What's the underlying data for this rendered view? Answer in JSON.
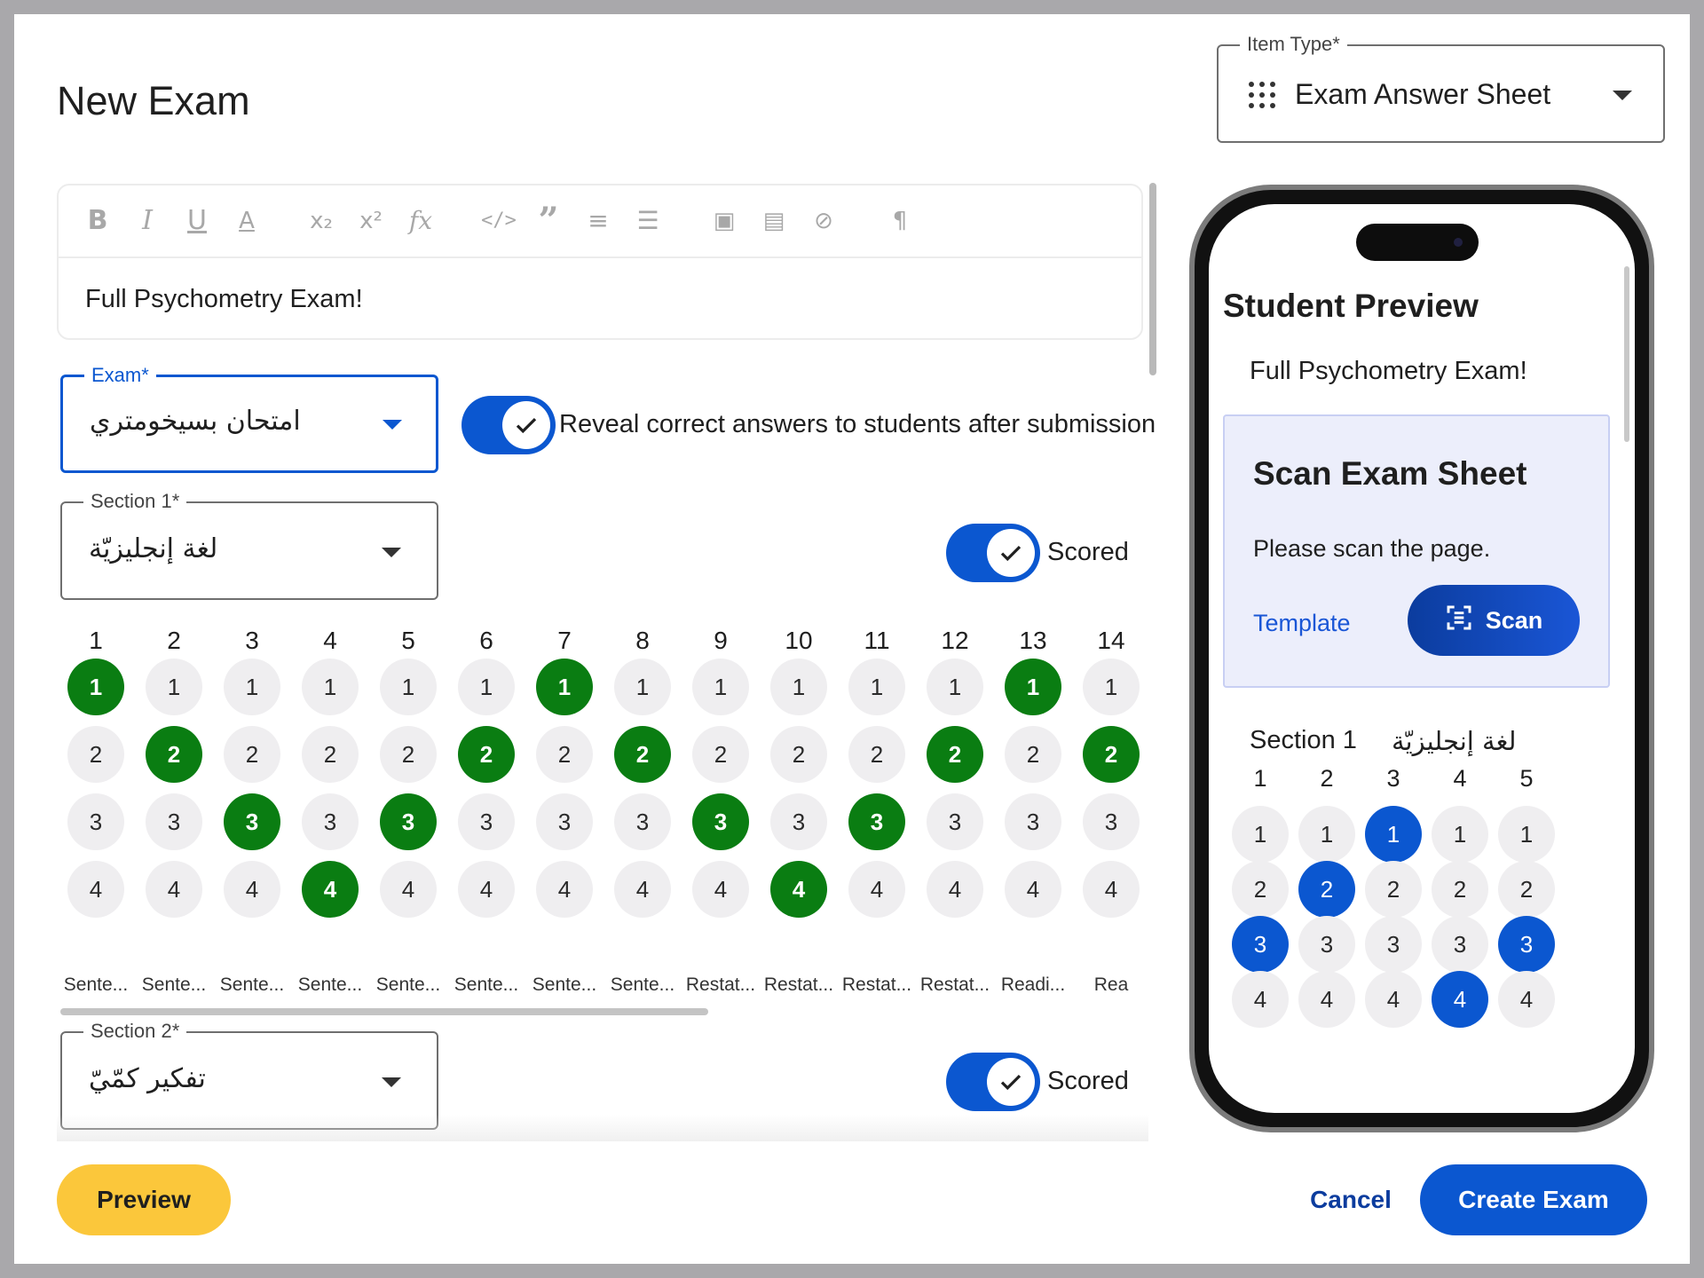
{
  "title": "New Exam",
  "item_type": {
    "label": "Item Type*",
    "value": "Exam Answer Sheet",
    "icon": "grid-dots-icon"
  },
  "editor": {
    "toolbar": [
      "bold",
      "italic",
      "underline",
      "text-color",
      "subscript",
      "superscript",
      "formula",
      "code",
      "blockquote",
      "numbered-list",
      "bulleted-list",
      "image",
      "video",
      "link",
      "rtl-paragraph"
    ],
    "text": "Full Psychometry Exam!"
  },
  "exam_select": {
    "label": "Exam*",
    "value": "امتحان بسيخومتري"
  },
  "reveal_toggle": {
    "label": "Reveal correct answers to students after submission",
    "on": true
  },
  "section1": {
    "label": "Section 1*",
    "value": "لغة إنجليزيّة",
    "scored_label": "Scored",
    "scored": true,
    "questions": [
      {
        "num": "1",
        "correct": 1,
        "name": "Sente..."
      },
      {
        "num": "2",
        "correct": 2,
        "name": "Sente..."
      },
      {
        "num": "3",
        "correct": 3,
        "name": "Sente..."
      },
      {
        "num": "4",
        "correct": 4,
        "name": "Sente..."
      },
      {
        "num": "5",
        "correct": 3,
        "name": "Sente..."
      },
      {
        "num": "6",
        "correct": 2,
        "name": "Sente..."
      },
      {
        "num": "7",
        "correct": 1,
        "name": "Sente..."
      },
      {
        "num": "8",
        "correct": 2,
        "name": "Sente..."
      },
      {
        "num": "9",
        "correct": 3,
        "name": "Restat..."
      },
      {
        "num": "10",
        "correct": 4,
        "name": "Restat..."
      },
      {
        "num": "11",
        "correct": 3,
        "name": "Restat..."
      },
      {
        "num": "12",
        "correct": 2,
        "name": "Restat..."
      },
      {
        "num": "13",
        "correct": 1,
        "name": "Readi..."
      },
      {
        "num": "14",
        "correct": 2,
        "name": "Rea"
      }
    ]
  },
  "section2": {
    "label": "Section 2*",
    "value": "تفكير كمّيّ",
    "scored_label": "Scored",
    "scored": true
  },
  "preview": {
    "title": "Student Preview",
    "subtitle": "Full Psychometry Exam!",
    "scan_card": {
      "title": "Scan Exam Sheet",
      "description": "Please scan the page.",
      "template_link": "Template",
      "scan_button": "Scan"
    },
    "section_label": "Section 1",
    "section_name": "لغة إنجليزيّة",
    "questions": [
      {
        "num": "1",
        "selected": 3
      },
      {
        "num": "2",
        "selected": 2
      },
      {
        "num": "3",
        "selected": 1
      },
      {
        "num": "4",
        "selected": 4
      },
      {
        "num": "5",
        "selected": 3
      }
    ]
  },
  "buttons": {
    "preview": "Preview",
    "cancel": "Cancel",
    "create": "Create Exam"
  },
  "colors": {
    "accent": "#0b57d0",
    "correct": "#0a7d12",
    "preview_btn": "#fbc73b"
  }
}
